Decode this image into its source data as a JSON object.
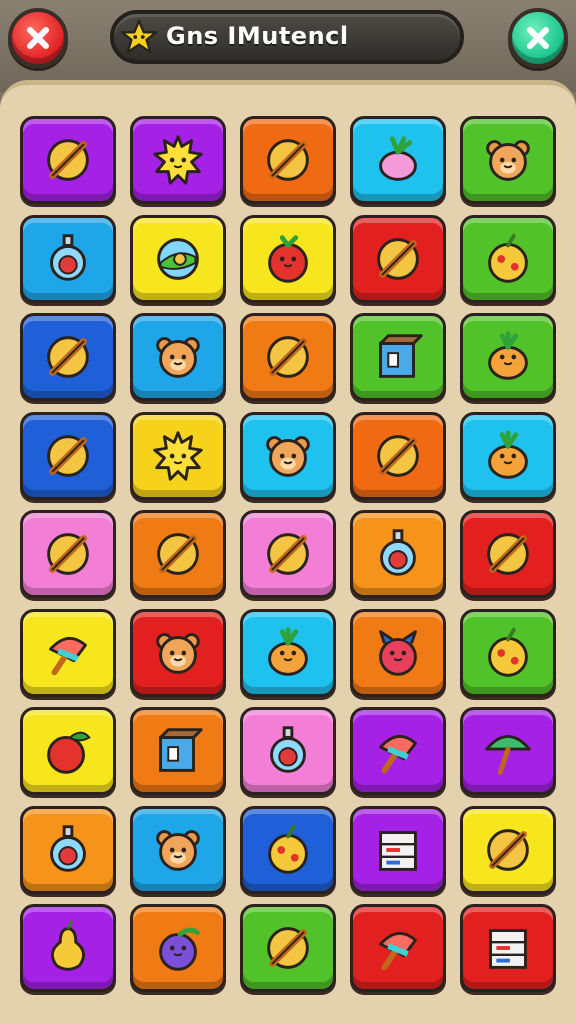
{
  "header": {
    "title": "Gns IMutencl",
    "close_button_icon": "x-icon",
    "confirm_button_icon": "x-icon",
    "close_button_color": "#e5272a",
    "confirm_button_color": "#22c98f",
    "title_icon": "star-icon"
  },
  "board": {
    "columns": 5,
    "rows": 9,
    "tiles": [
      {
        "color": "#a521e6",
        "icon": "pencil-icon"
      },
      {
        "color": "#a521e6",
        "icon": "sun-face-icon"
      },
      {
        "color": "#f06a14",
        "icon": "pencil-icon"
      },
      {
        "color": "#1fc2ef",
        "icon": "radish-icon"
      },
      {
        "color": "#52c22a",
        "icon": "bear-icon"
      },
      {
        "color": "#1fa6e8",
        "icon": "potion-icon"
      },
      {
        "color": "#f7e51d",
        "icon": "orb-icon"
      },
      {
        "color": "#f7e51d",
        "icon": "tomato-face-icon"
      },
      {
        "color": "#e2201f",
        "icon": "pencil-icon"
      },
      {
        "color": "#52c22a",
        "icon": "fruit-icon"
      },
      {
        "color": "#1f5fd8",
        "icon": "pencil-icon"
      },
      {
        "color": "#1fa6e8",
        "icon": "bear-icon"
      },
      {
        "color": "#f07a14",
        "icon": "pencil-icon"
      },
      {
        "color": "#52c22a",
        "icon": "box-icon"
      },
      {
        "color": "#52c22a",
        "icon": "pineapple-face-icon"
      },
      {
        "color": "#1f5fd8",
        "icon": "pencil-icon"
      },
      {
        "color": "#f7d21d",
        "icon": "sun-face-icon"
      },
      {
        "color": "#1fc2ef",
        "icon": "bear-icon"
      },
      {
        "color": "#f06a14",
        "icon": "pencil-icon"
      },
      {
        "color": "#1fc2ef",
        "icon": "pineapple-face-icon"
      },
      {
        "color": "#f27ed6",
        "icon": "pencil-icon"
      },
      {
        "color": "#f07a14",
        "icon": "pencil-icon"
      },
      {
        "color": "#f27ed6",
        "icon": "pencil-icon"
      },
      {
        "color": "#f5931a",
        "icon": "potion-icon"
      },
      {
        "color": "#e2201f",
        "icon": "pencil-icon"
      },
      {
        "color": "#f7e51d",
        "icon": "ice-cream-icon"
      },
      {
        "color": "#e2201f",
        "icon": "bear-icon"
      },
      {
        "color": "#1fc2ef",
        "icon": "pineapple-face-icon"
      },
      {
        "color": "#f07a14",
        "icon": "monster-icon"
      },
      {
        "color": "#52c22a",
        "icon": "fruit-icon"
      },
      {
        "color": "#f7e51d",
        "icon": "apple-icon"
      },
      {
        "color": "#f07a14",
        "icon": "box-icon"
      },
      {
        "color": "#f27ed6",
        "icon": "potion-icon"
      },
      {
        "color": "#a521e6",
        "icon": "ice-cream-icon"
      },
      {
        "color": "#a521e6",
        "icon": "umbrella-icon"
      },
      {
        "color": "#f5931a",
        "icon": "potion-icon"
      },
      {
        "color": "#1fa6e8",
        "icon": "bear-icon"
      },
      {
        "color": "#1f5fd8",
        "icon": "fruit-icon"
      },
      {
        "color": "#a521e6",
        "icon": "cabinet-icon"
      },
      {
        "color": "#f7e51d",
        "icon": "pencil-icon"
      },
      {
        "color": "#a521e6",
        "icon": "pear-icon"
      },
      {
        "color": "#f07a14",
        "icon": "plum-icon"
      },
      {
        "color": "#52c22a",
        "icon": "pencil-icon"
      },
      {
        "color": "#e2201f",
        "icon": "ice-cream-icon"
      },
      {
        "color": "#e2201f",
        "icon": "cabinet-icon"
      }
    ]
  }
}
